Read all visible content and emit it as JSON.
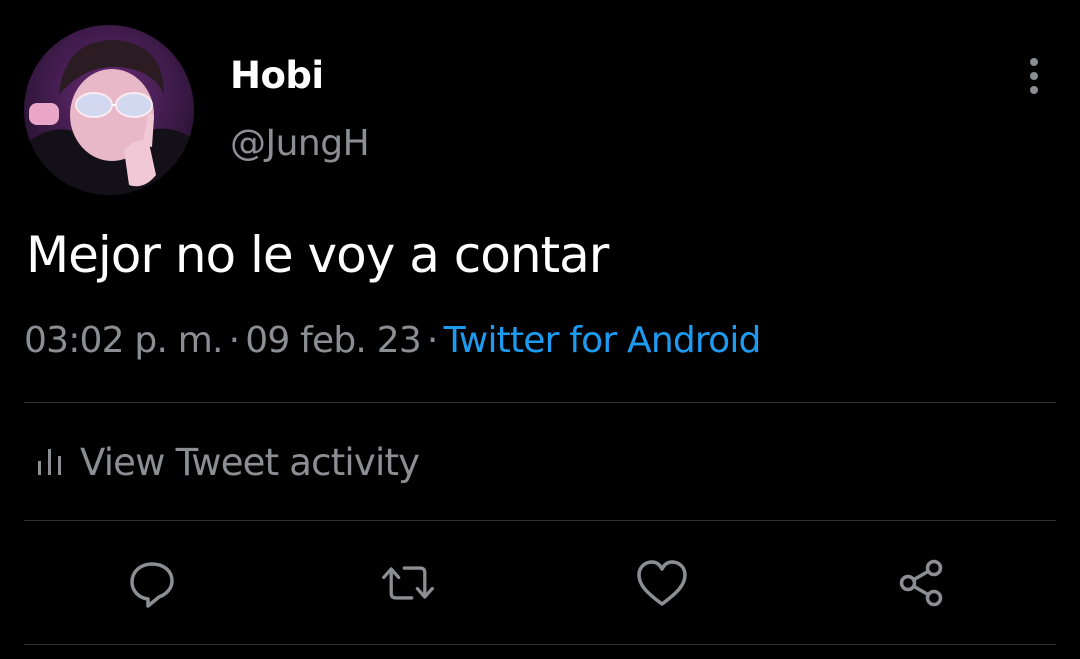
{
  "author": {
    "display_name": "Hobi",
    "handle": "@JungH"
  },
  "tweet": {
    "text": "Mejor no le voy a contar",
    "time": "03:02 p. m.",
    "date": "09 feb. 23",
    "separator": "·",
    "source": "Twitter for Android"
  },
  "activity": {
    "label": "View Tweet activity"
  },
  "actions": [
    "reply-icon",
    "retweet-icon",
    "like-icon",
    "share-icon"
  ],
  "colors": {
    "background": "#000000",
    "text": "#ffffff",
    "muted": "#8b8f94",
    "accent": "#1d9bf0",
    "divider": "#2f3336"
  }
}
